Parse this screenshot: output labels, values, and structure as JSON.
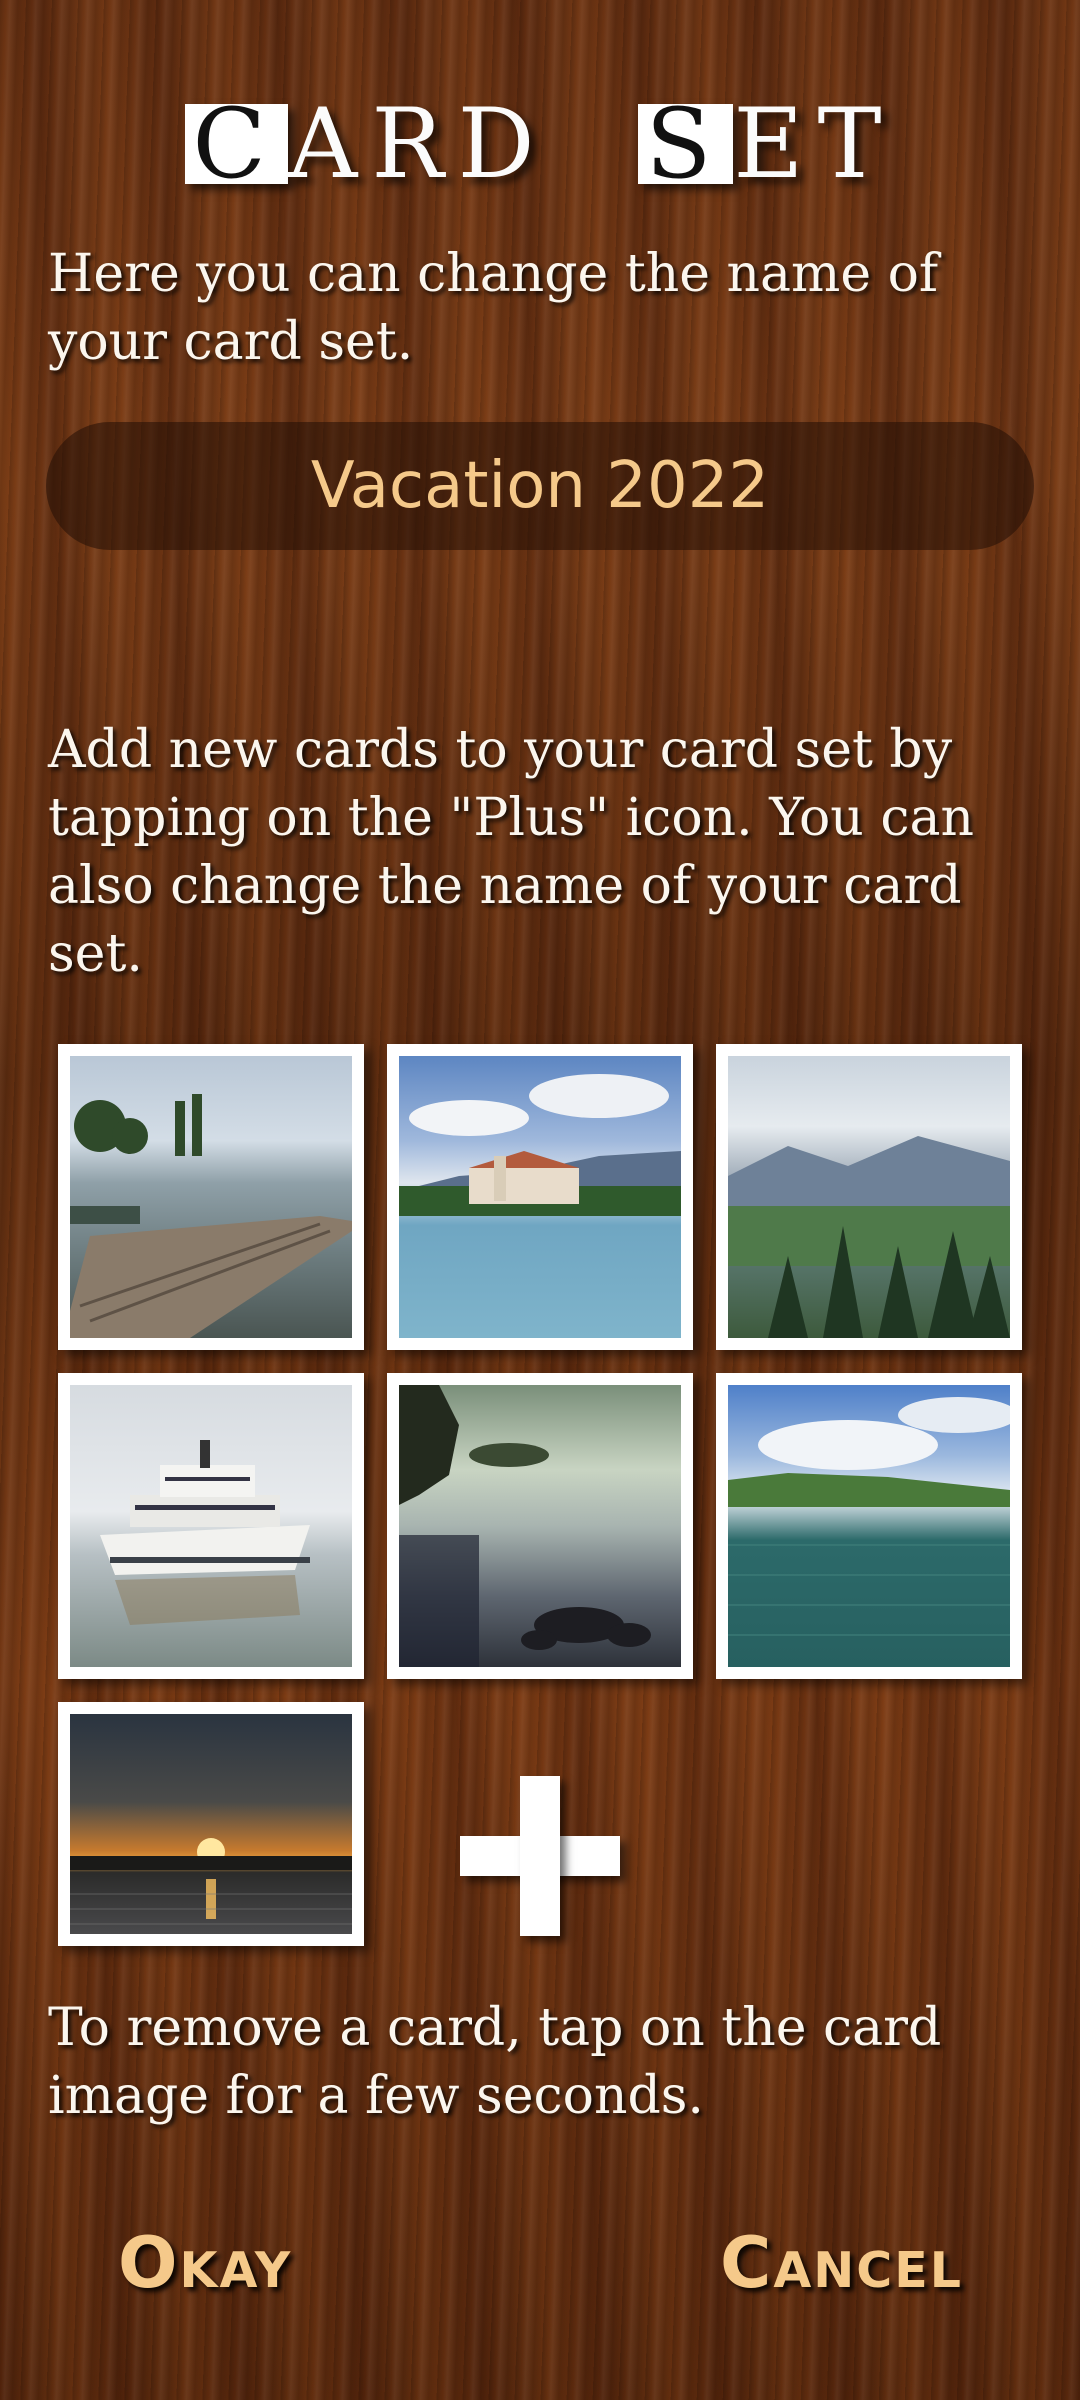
{
  "header": {
    "title_part1": "CARD",
    "title_part2": "SET"
  },
  "intro_text": "Here you can change the name of your card set.",
  "name_field": {
    "value": "Vacation 2022"
  },
  "add_cards_text": "Add new cards to your card set by tapping on the \"Plus\" icon. You can also change the name of your card set.",
  "cards": [
    {
      "subject": "wooden pier on lake"
    },
    {
      "subject": "castle on island"
    },
    {
      "subject": "mountain valley with firs"
    },
    {
      "subject": "passenger ship"
    },
    {
      "subject": "lake shore rocks"
    },
    {
      "subject": "lake with green shore"
    },
    {
      "subject": "sunset over lake"
    }
  ],
  "add_icon": "plus-icon",
  "remove_hint_text": "To remove a card, tap on the card image for a few seconds.",
  "buttons": {
    "okay": "Okay",
    "cancel": "Cancel"
  },
  "colors": {
    "accent": "#f5c98a",
    "text": "#fbf6ee",
    "card_frame": "#ffffff"
  }
}
